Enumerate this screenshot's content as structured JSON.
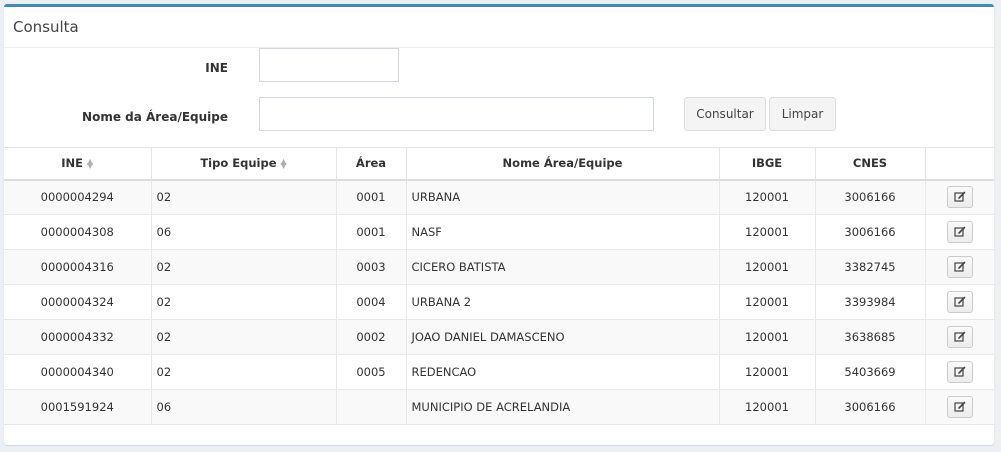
{
  "panel": {
    "title": "Consulta"
  },
  "form": {
    "ine_label": "INE",
    "ine_value": "",
    "nome_label": "Nome da Área/Equipe",
    "nome_value": "",
    "consultar_label": "Consultar",
    "limpar_label": "Limpar"
  },
  "table": {
    "columns": [
      {
        "label": "INE",
        "sortable": true
      },
      {
        "label": "Tipo Equipe",
        "sortable": true
      },
      {
        "label": "Área",
        "sortable": false
      },
      {
        "label": "Nome Área/Equipe",
        "sortable": false
      },
      {
        "label": "IBGE",
        "sortable": false
      },
      {
        "label": "CNES",
        "sortable": false
      },
      {
        "label": "",
        "sortable": false
      }
    ],
    "rows": [
      {
        "ine": "0000004294",
        "tipo": "02",
        "area": "0001",
        "nome": "URBANA",
        "ibge": "120001",
        "cnes": "3006166"
      },
      {
        "ine": "0000004308",
        "tipo": "06",
        "area": "0001",
        "nome": "NASF",
        "ibge": "120001",
        "cnes": "3006166"
      },
      {
        "ine": "0000004316",
        "tipo": "02",
        "area": "0003",
        "nome": "CICERO BATISTA",
        "ibge": "120001",
        "cnes": "3382745"
      },
      {
        "ine": "0000004324",
        "tipo": "02",
        "area": "0004",
        "nome": "URBANA 2",
        "ibge": "120001",
        "cnes": "3393984"
      },
      {
        "ine": "0000004332",
        "tipo": "02",
        "area": "0002",
        "nome": "JOAO DANIEL DAMASCENO",
        "ibge": "120001",
        "cnes": "3638685"
      },
      {
        "ine": "0000004340",
        "tipo": "02",
        "area": "0005",
        "nome": "REDENCAO",
        "ibge": "120001",
        "cnes": "5403669"
      },
      {
        "ine": "0001591924",
        "tipo": "06",
        "area": "",
        "nome": "MUNICIPIO DE ACRELANDIA",
        "ibge": "120001",
        "cnes": "3006166"
      }
    ]
  },
  "icons": {
    "edit": "edit-icon",
    "sort": "sort-icon"
  },
  "colors": {
    "accent": "#3c8dbc",
    "row_stripe": "#f9f9f9"
  }
}
